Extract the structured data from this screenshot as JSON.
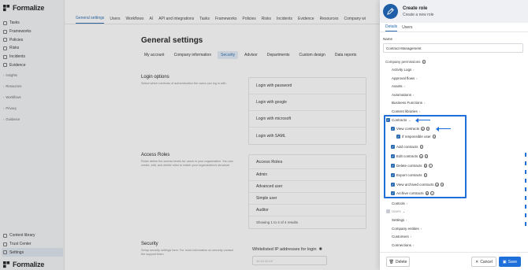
{
  "app": {
    "logo_text": "Formalize"
  },
  "sidebar": {
    "items": [
      {
        "label": "Tasks",
        "icon": "tasks-icon"
      },
      {
        "label": "Frameworks",
        "icon": "frameworks-icon"
      },
      {
        "label": "Policies",
        "icon": "policies-icon"
      },
      {
        "label": "Risks",
        "icon": "risks-icon"
      },
      {
        "label": "Incidents",
        "icon": "incidents-icon"
      },
      {
        "label": "Evidence",
        "icon": "evidence-icon"
      }
    ],
    "groups": [
      "Insights",
      "Resources",
      "Workflows",
      "Privacy",
      "Guidance"
    ],
    "bottom_items": [
      {
        "label": "Content library",
        "icon": "library-icon"
      },
      {
        "label": "Trust Center",
        "icon": "trust-icon"
      },
      {
        "label": "Settings",
        "icon": "settings-icon"
      }
    ]
  },
  "top_tabs": [
    "General settings",
    "Users",
    "Workflows",
    "AI",
    "API and integrations",
    "Tasks",
    "Frameworks",
    "Policies",
    "Risks",
    "Incidents",
    "Evidence",
    "Resources",
    "Company wi"
  ],
  "main": {
    "title": "General settings",
    "subtabs": [
      "My account",
      "Company information",
      "Security",
      "Advisor",
      "Departments",
      "Custom design",
      "Data reports"
    ],
    "login_options": {
      "title": "Login options",
      "desc": "Select which methods of authentication the users can log in with.",
      "rows": [
        "Login with password",
        "Login with google",
        "Login with microsoft",
        "Login with SAML"
      ]
    },
    "access_roles": {
      "title": "Access Roles",
      "desc": "Roles define the access levels for users in your organization. You can create, edit, and delete roles to match your organization's structure.",
      "header": "Access Roles",
      "rows": [
        "Admin",
        "Advanced user",
        "Simple user",
        "Auditor"
      ],
      "footer": "Showing 1 to 4 of 4 results"
    },
    "security": {
      "title": "Security",
      "desc": "Setup security settings here. For more information on security contact the support team.",
      "ip_label": "Whitelisted IP addresses for login",
      "ip_placeholder": "10.10.10.10"
    }
  },
  "panel": {
    "title": "Create role",
    "subtitle": "Create a new role",
    "tabs": [
      "Details",
      "Users"
    ],
    "name_label": "Name",
    "name_value": "Contract Management",
    "permissions_label": "Company permissions",
    "permissions": {
      "activity_logs": "Activity Logs",
      "approval_flows": "Approval flows",
      "assets": "Assets",
      "automations": "Automations",
      "business_functions": "Business Functions",
      "content_libraries": "Content libraries",
      "contracts": "Contracts",
      "view_contracts": "View contracts",
      "if_responsible_user": "If responsible user",
      "add_contracts": "Add contracts",
      "edit_contracts": "Edit contracts",
      "delete_contracts": "Delete contracts",
      "export_contracts": "Export contracts",
      "view_archived_contracts": "View archived contracts",
      "archive_contracts": "Archive contracts",
      "controls": "Controls",
      "users": "Users",
      "settings": "Settings",
      "company_entities": "Company entities",
      "customers": "Customers",
      "connections": "Connections"
    },
    "buttons": {
      "delete": "Delete",
      "cancel": "Cancel",
      "save": "Save"
    }
  },
  "colors": {
    "accent": "#1e6fd9",
    "highlight_border": "#1e6fd9"
  }
}
